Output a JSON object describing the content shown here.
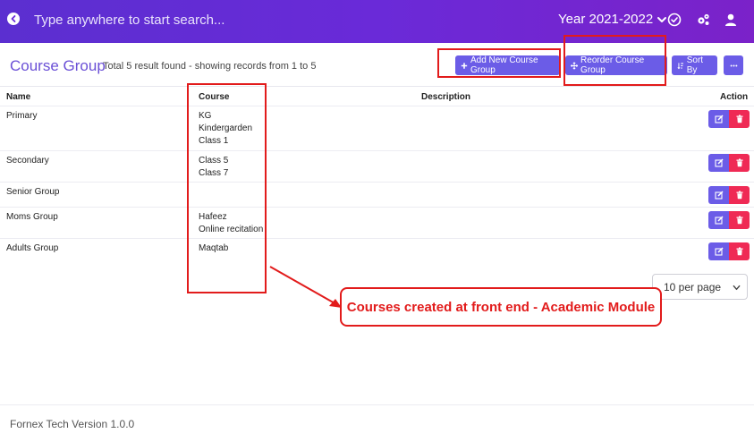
{
  "topbar": {
    "search_placeholder": "Type anywhere to start search...",
    "year_label": "Year 2021-2022"
  },
  "header": {
    "title": "Course Group",
    "record_info": "Total 5 result found - showing records from 1 to 5",
    "add_button": "Add New Course Group",
    "reorder_button": "Reorder Course Group",
    "sort_button": "Sort By"
  },
  "table": {
    "columns": [
      "Name",
      "Course",
      "Description",
      "Action"
    ],
    "rows": [
      {
        "name": "Primary",
        "courses": [
          "KG",
          "Kindergarden",
          "Class 1"
        ]
      },
      {
        "name": "Secondary",
        "courses": [
          "Class 5",
          "Class 7"
        ]
      },
      {
        "name": "Senior Group",
        "courses": []
      },
      {
        "name": "Moms Group",
        "courses": [
          "Hafeez",
          "Online recitation"
        ]
      },
      {
        "name": "Adults Group",
        "courses": [
          "Maqtab"
        ]
      }
    ]
  },
  "pagination": {
    "per_page": "10 per page"
  },
  "annotation": {
    "label": "Courses created at front end - Academic Module"
  },
  "footer": {
    "version": "Fornex Tech Version 1.0.0"
  },
  "colors": {
    "accent": "#6b5ce7",
    "danger": "#ef2a55",
    "annotation": "#e21b1b"
  }
}
